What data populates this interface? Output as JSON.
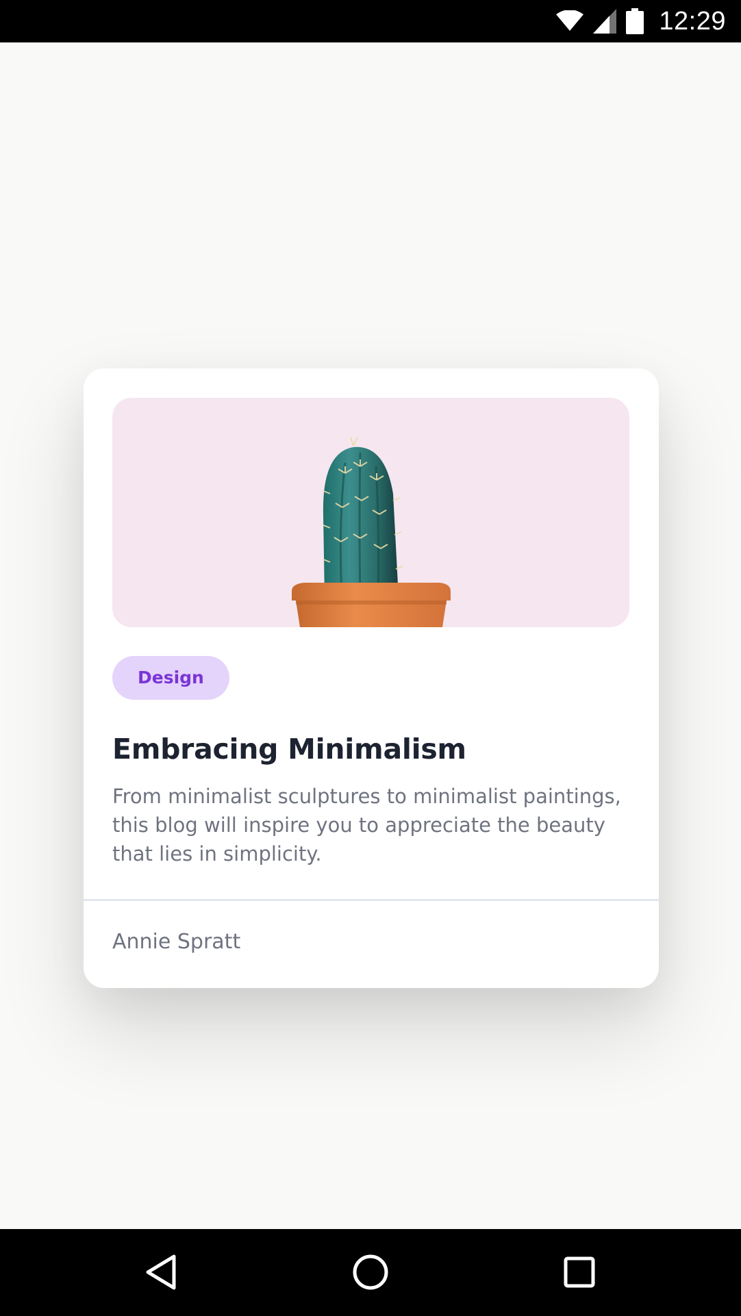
{
  "status_bar": {
    "time": "12:29",
    "icons": [
      "wifi-icon",
      "cell-signal-icon",
      "battery-icon"
    ]
  },
  "card": {
    "image": {
      "subject": "cactus-in-pot",
      "background_color": "#f6e6f0"
    },
    "tag": "Design",
    "title": "Embracing Minimalism",
    "description": "From minimalist sculptures to minimalist paintings, this blog will inspire you to appreciate the beauty that lies in simplicity.",
    "author": "Annie Spratt"
  },
  "nav_bar": {
    "buttons": [
      "back-icon",
      "home-icon",
      "recents-icon"
    ]
  },
  "colors": {
    "tag_bg": "#e4d3fa",
    "tag_text": "#7a35d6",
    "title": "#1d2330",
    "body_text": "#6f7380",
    "page_bg": "#f9f9f8"
  }
}
